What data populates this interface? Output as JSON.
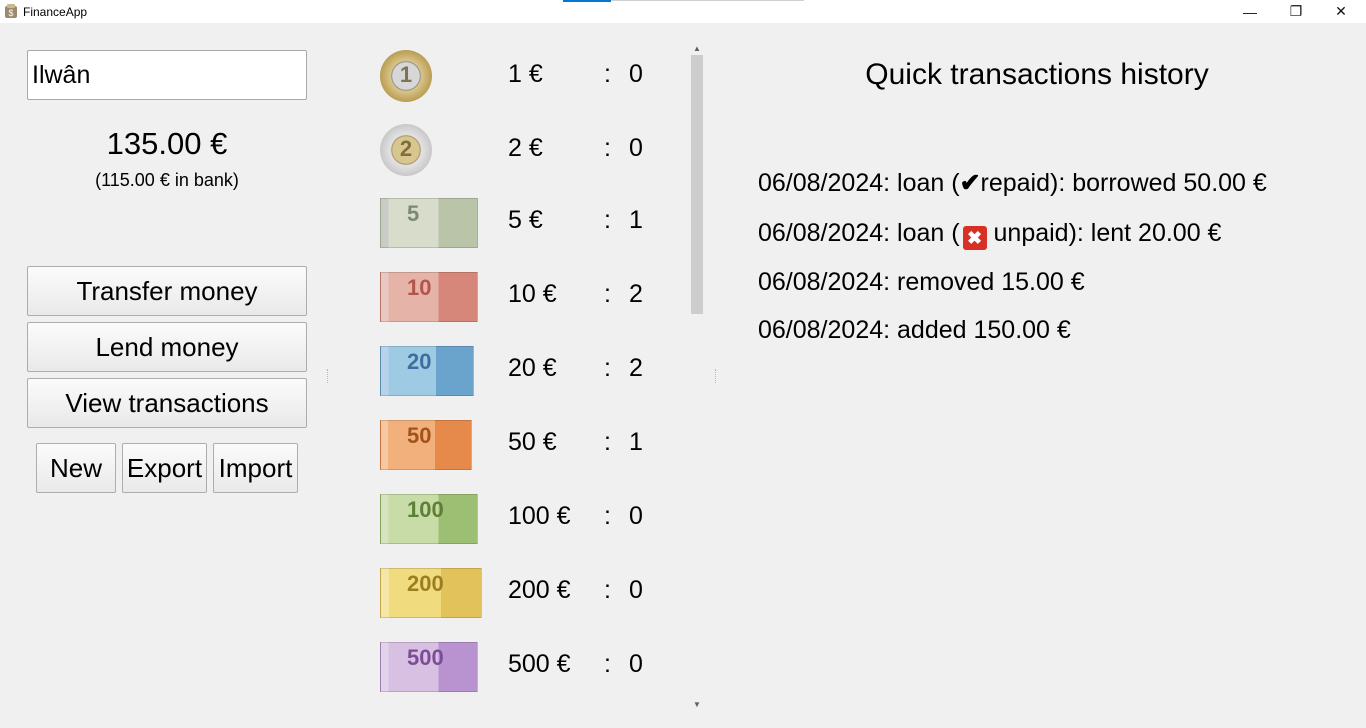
{
  "window": {
    "title": "FinanceApp",
    "minimize": "—",
    "maximize": "❐",
    "close": "✕"
  },
  "account": {
    "name": "Ilwân",
    "total": "135.00 €",
    "bank": "(115.00 € in bank)"
  },
  "actions": {
    "transfer": "Transfer money",
    "lend": "Lend money",
    "view": "View transactions",
    "new": "New",
    "export": "Export",
    "import": "Import"
  },
  "denominations": [
    {
      "label": "1 €",
      "count": "0",
      "art": "1"
    },
    {
      "label": "2 €",
      "count": "0",
      "art": "2"
    },
    {
      "label": "5 €",
      "count": "1",
      "art": "5"
    },
    {
      "label": "10 €",
      "count": "2",
      "art": "10"
    },
    {
      "label": "20 €",
      "count": "2",
      "art": "20"
    },
    {
      "label": "50 €",
      "count": "1",
      "art": "50"
    },
    {
      "label": "100 €",
      "count": "0",
      "art": "100"
    },
    {
      "label": "200 €",
      "count": "0",
      "art": "200"
    },
    {
      "label": "500 €",
      "count": "0",
      "art": "500"
    }
  ],
  "colon": ":",
  "history": {
    "title": "Quick transactions history",
    "items": [
      {
        "pre": "06/08/2024: loan (",
        "mark": "✔",
        "post": "repaid): borrowed 50.00 €"
      },
      {
        "pre": "06/08/2024: loan (",
        "mark": "✖",
        "post": " unpaid): lent 20.00 €"
      },
      {
        "pre": "06/08/2024: removed 15.00 €"
      },
      {
        "pre": "06/08/2024: added 150.00 €"
      }
    ]
  },
  "scroll": {
    "up": "▲",
    "down": "▼"
  }
}
